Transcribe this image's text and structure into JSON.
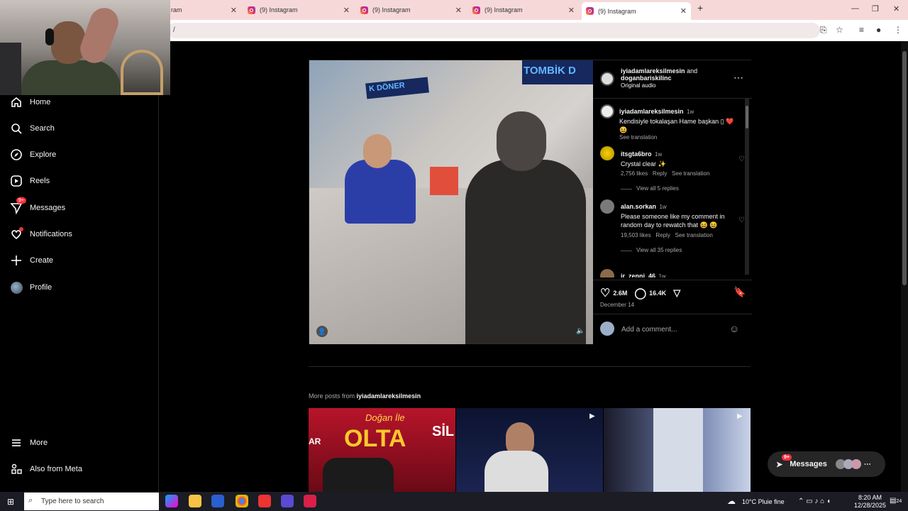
{
  "tabs": [
    {
      "label": "ram",
      "active": false
    },
    {
      "label": "(9) Instagram",
      "active": false
    },
    {
      "label": "(9) Instagram",
      "active": false
    },
    {
      "label": "(9) Instagram",
      "active": false
    },
    {
      "label": "(9) Instagram",
      "active": true
    }
  ],
  "address_text": "/",
  "sidebar": {
    "items": [
      {
        "label": "Home",
        "icon": "home-icon"
      },
      {
        "label": "Search",
        "icon": "search-icon"
      },
      {
        "label": "Explore",
        "icon": "compass-icon"
      },
      {
        "label": "Reels",
        "icon": "reels-icon"
      },
      {
        "label": "Messages",
        "icon": "messenger-icon",
        "badge": "9+"
      },
      {
        "label": "Notifications",
        "icon": "heart-icon"
      },
      {
        "label": "Create",
        "icon": "plus-icon"
      },
      {
        "label": "Profile",
        "icon": "avatar-icon"
      }
    ],
    "bottom": [
      {
        "label": "More",
        "icon": "menu-icon"
      },
      {
        "label": "Also from Meta",
        "icon": "meta-icon"
      }
    ]
  },
  "post": {
    "author_line1": "iyiadamlareksilmesin",
    "and_text": "and",
    "author_line2": "doganbariskilinc",
    "audio": "Original audio",
    "video_signs": [
      "TOMBİK D",
      "K DÖNER"
    ],
    "caption": {
      "user": "iyiadamlareksilmesin",
      "time": "1w",
      "text": "Kendisiyle tokalaşan Hame başkan ▯ ❤️",
      "emoji": "😆",
      "translate": "See translation"
    },
    "comments": [
      {
        "user": "itsgta6bro",
        "time": "1w",
        "text": "Crystal clear ✨",
        "likes": "2,756 likes",
        "reply": "Reply",
        "translate": "See translation",
        "view_replies": "View all 5 replies"
      },
      {
        "user": "alan.sorkan",
        "time": "1w",
        "text": "Please someone like my comment in random day to rewatch that 😆 😆",
        "likes": "19,503 likes",
        "reply": "Reply",
        "translate": "See translation",
        "view_replies": "View all 35 replies"
      },
      {
        "user": "jr_zenni_46",
        "time": "1w"
      }
    ],
    "likes": "2.6M",
    "comments_count": "16.4K",
    "date": "December 14",
    "add_comment_placeholder": "Add a comment..."
  },
  "more_posts": {
    "prefix": "More posts from",
    "user": "iyiadamlareksilmesin",
    "thumb1_text": "OLTA",
    "thumb1_top": "Doğan İle",
    "thumb1_side": "SİL",
    "thumb1_left": "AR"
  },
  "messages_pill": {
    "label": "Messages",
    "badge": "9+"
  },
  "taskbar": {
    "search_placeholder": "Type here to search",
    "weather": "10°C  Pluie fine",
    "time": "8:20 AM",
    "date": "12/28/2025",
    "notif_count": "24"
  },
  "colors": {
    "accent_red": "#ff3040",
    "bg": "#000000",
    "tab_strip": "#f7d8d8"
  }
}
